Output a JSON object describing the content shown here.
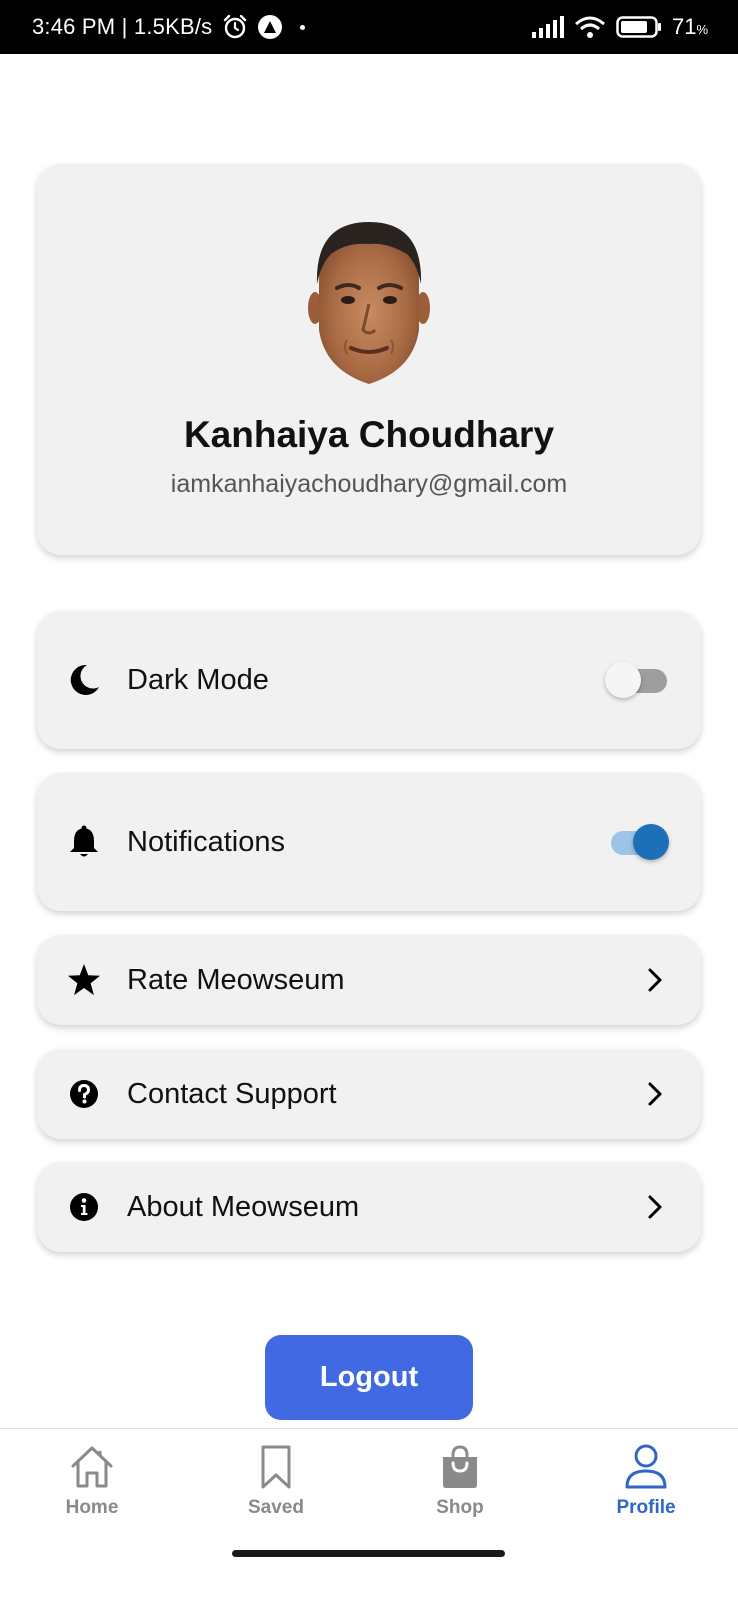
{
  "status_bar": {
    "time": "3:46 PM",
    "speed": "1.5KB/s",
    "battery_percent": "71",
    "battery_unit": "%"
  },
  "profile": {
    "name": "Kanhaiya Choudhary",
    "email": "iamkanhaiyachoudhary@gmail.com"
  },
  "settings": {
    "dark_mode": {
      "label": "Dark Mode",
      "enabled": false,
      "icon": "moon-icon"
    },
    "notifications": {
      "label": "Notifications",
      "enabled": true,
      "icon": "bell-icon"
    },
    "rate": {
      "label": "Rate Meowseum",
      "icon": "star-icon"
    },
    "contact": {
      "label": "Contact Support",
      "icon": "help-circle-icon"
    },
    "about": {
      "label": "About Meowseum",
      "icon": "info-circle-icon"
    }
  },
  "logout_label": "Logout",
  "bottom_nav": {
    "items": [
      {
        "label": "Home",
        "icon": "home-icon",
        "active": false
      },
      {
        "label": "Saved",
        "icon": "bookmark-icon",
        "active": false
      },
      {
        "label": "Shop",
        "icon": "shopping-bag-icon",
        "active": false
      },
      {
        "label": "Profile",
        "icon": "user-icon",
        "active": true
      }
    ]
  },
  "colors": {
    "accent": "#4169e1",
    "active_nav": "#2f66c8",
    "toggle_on": "#1d6fb8",
    "card_bg": "#f1f1f1"
  }
}
